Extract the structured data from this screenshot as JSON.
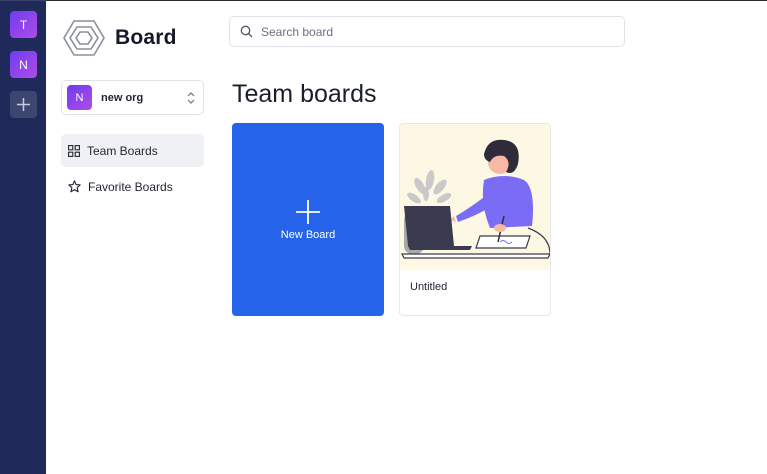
{
  "app": {
    "logo_text": "Board"
  },
  "rail": {
    "orgs": [
      {
        "initial": "T"
      },
      {
        "initial": "N"
      }
    ],
    "add_icon": "plus-icon"
  },
  "search": {
    "placeholder": "Search board",
    "value": ""
  },
  "org_selector": {
    "initial": "N",
    "name": "new org"
  },
  "sidebar": {
    "items": [
      {
        "label": "Team Boards",
        "icon": "grid-icon",
        "active": true
      },
      {
        "label": "Favorite Boards",
        "icon": "star-icon",
        "active": false
      }
    ]
  },
  "main": {
    "title": "Team boards",
    "new_board_label": "New Board",
    "boards": [
      {
        "title": "Untitled",
        "thumbnail": "person-at-laptop-illustration"
      }
    ]
  },
  "colors": {
    "rail_bg": "#1f2a5a",
    "accent": "#2563eb",
    "org_gradient_start": "#6e3cf0",
    "org_gradient_end": "#b04ce8"
  }
}
